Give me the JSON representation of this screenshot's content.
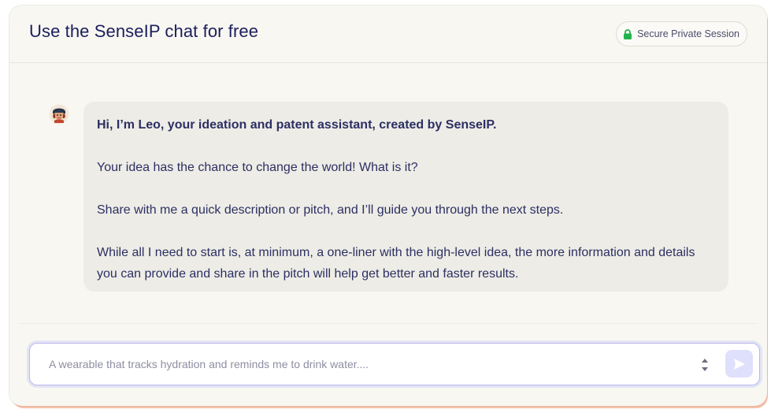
{
  "header": {
    "title": "Use the SenseIP chat for free",
    "session_badge": {
      "label": "Secure Private Session",
      "icon": "lock-icon",
      "icon_color": "#22b24c"
    }
  },
  "messages": [
    {
      "sender": "assistant",
      "avatar": "leo-avatar",
      "paragraphs": {
        "intro": "Hi, I’m Leo, your ideation and patent assistant, created by SenseIP.",
        "p2": "Your idea has the chance to change the world! What is it?",
        "p3": "Share with me a quick description or pitch, and I’ll guide you through the next steps.",
        "p4": "While all I need to start is, at minimum, a one-liner with the high-level idea, the more information and details you can provide and share in the pitch will help get better and faster results."
      }
    }
  ],
  "composer": {
    "value": "",
    "placeholder": "A wearable that tracks hydration and reminds me to drink water....",
    "send_icon": "send-icon",
    "send_button_color": "#dfe0fb"
  },
  "colors": {
    "title": "#1c1e5c",
    "text": "#2c2f63",
    "bubble_bg": "#edece6",
    "panel_bg": "#f8f7f2",
    "accent": "#b9b9ef"
  }
}
